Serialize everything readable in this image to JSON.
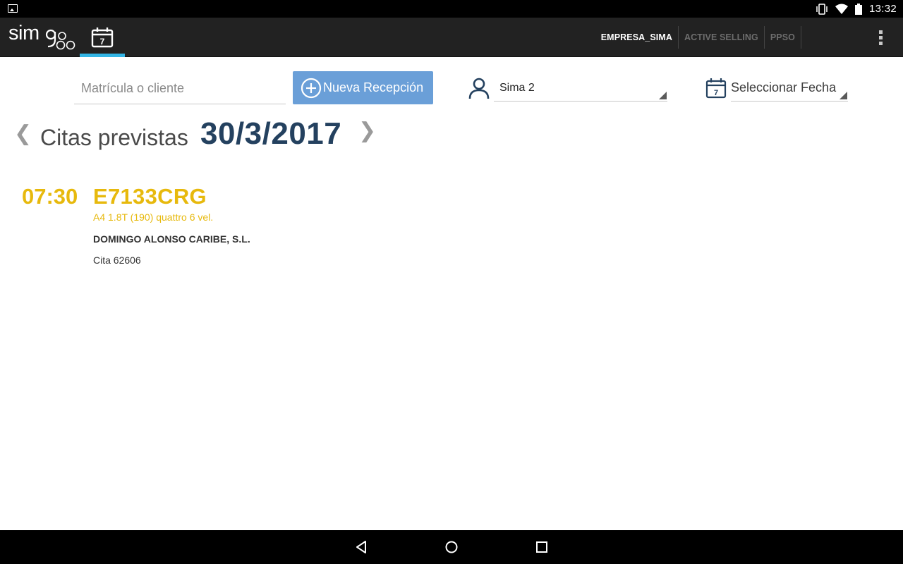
{
  "status_bar": {
    "time": "13:32",
    "icons": [
      "image-notification-icon",
      "vibrate-icon",
      "wifi-icon",
      "battery-icon"
    ]
  },
  "action_bar": {
    "logo_text": "simgo",
    "tabs": [
      {
        "name": "calendar",
        "icon": "calendar-icon",
        "day": "7",
        "selected": true
      }
    ],
    "menu_items": [
      {
        "label": "EMPRESA_SIMA",
        "active": true
      },
      {
        "label": "ACTIVE SELLING",
        "active": false
      },
      {
        "label": "PPSO",
        "active": false
      }
    ],
    "overflow_icon": "overflow-menu-icon"
  },
  "toolbar": {
    "search_placeholder": "Matrícula o cliente",
    "search_value": "",
    "new_button_label": "Nueva Recepción",
    "user_select_value": "Sima 2",
    "date_select_label": "Seleccionar Fecha",
    "date_icon_day": "7"
  },
  "header": {
    "title": "Citas previstas",
    "date": "30/3/2017",
    "prev_icon": "❮",
    "next_icon": "❯"
  },
  "appointments": [
    {
      "time": "07:30",
      "plate": "E7133CRG",
      "model": "A4 1.8T (190) quattro 6 vel.",
      "client": "DOMINGO ALONSO CARIBE, S.L.",
      "cita": "Cita 62606"
    }
  ],
  "colors": {
    "accent_yellow": "#e7b90d",
    "date_navy": "#24415f",
    "button_blue": "#6a9fd8",
    "tab_indicator": "#33b5e5",
    "action_bar": "#222222"
  }
}
